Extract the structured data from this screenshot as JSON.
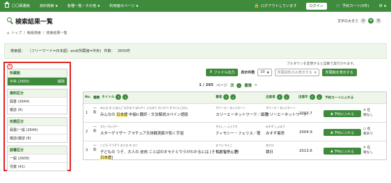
{
  "topnav": {
    "home": "〇〇図書館",
    "menu1": "資料検索",
    "menu2": "各種一覧・その他",
    "menu3": "利用者のページ",
    "logout_status": "ログアウトしています",
    "login": "ログイン",
    "cart": "予約カート(0件)"
  },
  "title": "検索結果一覧",
  "fontsize": {
    "label": "文字の大きさ",
    "small": "小",
    "medium": "中",
    "large": "大"
  },
  "breadcrumb": {
    "top": "トップ",
    "simple": "簡易検索",
    "current": "検索結果一覧"
  },
  "condition": {
    "label": "検索語：",
    "query": "（フリーワード=日本語）and(所蔵館=中央)",
    "count_label": "件数：",
    "count": "2650件"
  },
  "sidebar": {
    "marker": "①",
    "facets": [
      {
        "name": "所蔵館",
        "rows": [
          {
            "label": "中央 (2650)",
            "action": "解除",
            "selected": true
          }
        ]
      },
      {
        "name": "資料区分",
        "rows": [
          {
            "label": "図書 (2644)"
          },
          {
            "label": "雑誌 (6)"
          }
        ]
      },
      {
        "name": "形態区分",
        "rows": [
          {
            "label": "図書(一般 (2644)"
          },
          {
            "label": "雑誌(雑誌 (6)"
          }
        ]
      },
      {
        "name": "読書区分",
        "rows": [
          {
            "label": "一般 (2609)"
          },
          {
            "label": "児童 (41)"
          }
        ]
      }
    ]
  },
  "toolbar": {
    "note": "プルダウンを変更すると自動で実行されます。",
    "file_output": "ファイル出力",
    "display_count_label": "表示件数",
    "display_count": "10",
    "filter_select": "所蔵資料のみ表示する",
    "show_holdings": "所蔵館を表示する"
  },
  "pager": {
    "page": "1 / 265",
    "unit": "ページ",
    "next": "次",
    "last": "最後"
  },
  "table": {
    "headers": {
      "no": "No.",
      "cat": "種類",
      "title": "タイトル",
      "author": "著者",
      "publisher": "出版者",
      "year": "出版年",
      "reserve": "予約カートに入れる"
    },
    "rows": [
      {
        "no": "1",
        "cat": "一般",
        "rubi": "みんな の にほんご なかまで  ほんやく ぶんぽう かいせつ すぺいんごばん",
        "title_pre": "みんなの ",
        "title_hl": "日本語",
        "title_post": " 中級II 翻訳・文法解説スペイン語版",
        "author_rubi": "すりーえー ねっとわーく",
        "author": "スリーエーネットワーク／編著",
        "publisher_rubi": "すりーえー ねっとわーく",
        "publisher": "スリーエーネットワーク",
        "year": "2013.7",
        "reserve": "予約に入れる",
        "status1": "× 在",
        "status2": "架なし"
      },
      {
        "no": "2",
        "cat": "一般",
        "rubi": "すたーだいざー",
        "title_pre": "スターゲイザー  アマチュア天体観測家が拓く宇宙",
        "title_hl": "",
        "title_post": "",
        "author_rubi": "ちもしー ふぇりす",
        "author": "ティモシー・フェリス／著",
        "publisher_rubi": "みすず しょぼう",
        "publisher": "みすず書房",
        "year": "2004.9",
        "reserve": "予約に入れる",
        "status1": "○ 在",
        "status2": "架あり"
      },
      {
        "no": "3",
        "cat": "一般",
        "rubi": "こども そうぞう おとな の ひご",
        "title_pre": "子どもの うそ、大人の 皮肉  ことばのオモテとウラがわかるには [そうだったんだ!",
        "title_hl": "日本語",
        "title_post": "]",
        "author_rubi": "まつい ちえこ",
        "author": "松井智子／著",
        "publisher_rubi": "あさひ",
        "publisher": "朝日",
        "year": "2013.6",
        "reserve": "予約に入れる",
        "status1": "× 在",
        "status2": "架なし"
      }
    ]
  }
}
